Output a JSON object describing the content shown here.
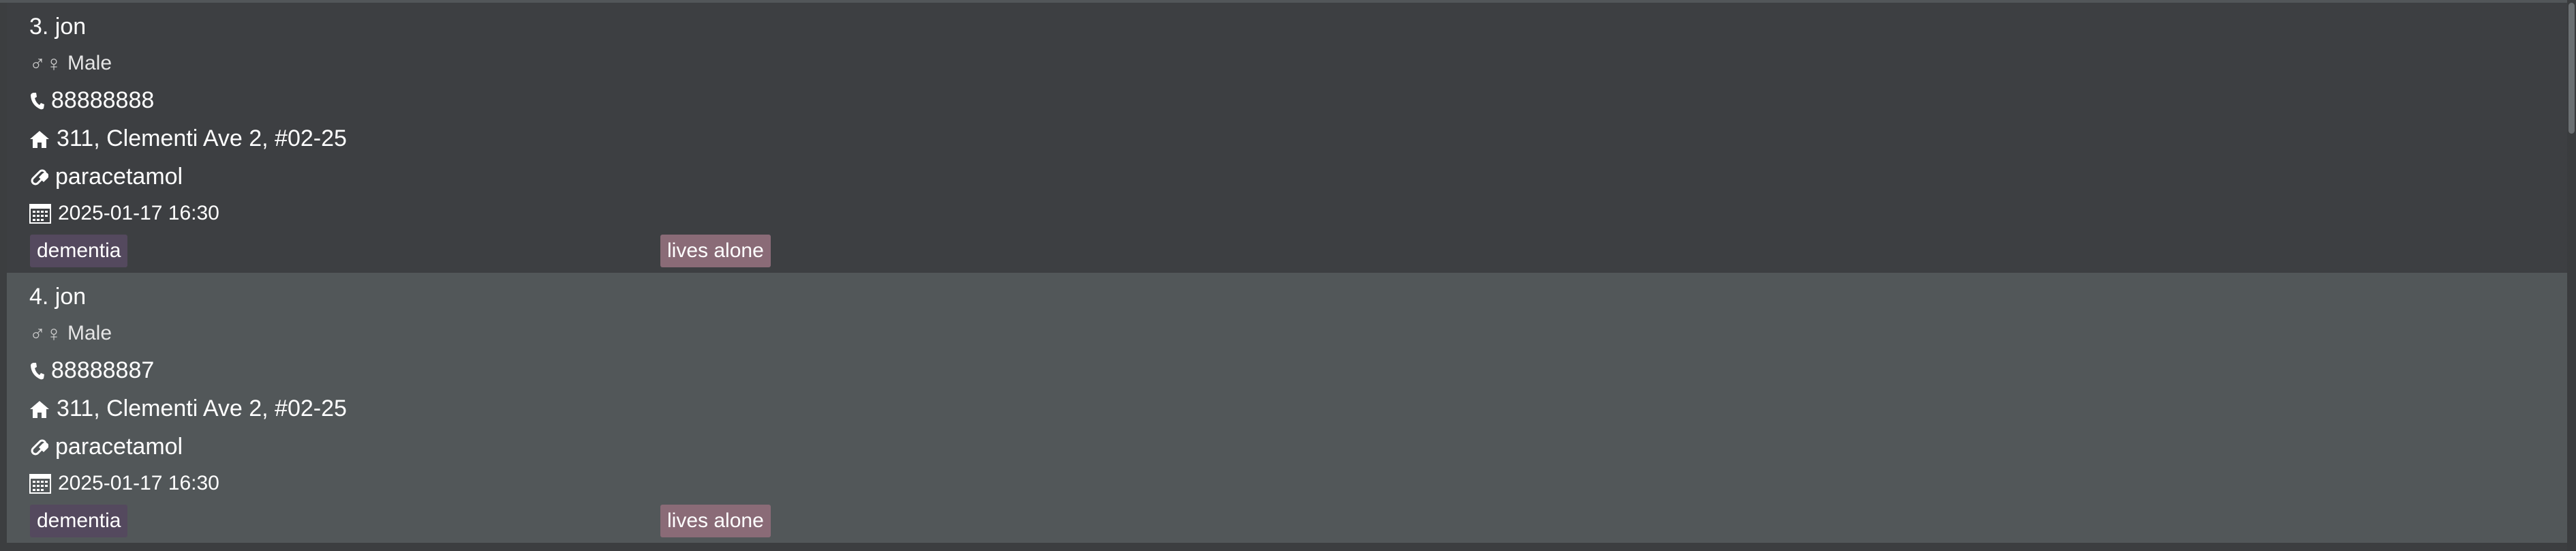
{
  "persons": [
    {
      "index_name": "3. jon",
      "gender": "Male",
      "phone": "88888888",
      "address": "311, Clementi Ave 2, #02-25",
      "medication": "paracetamol",
      "appointment": "2025-01-17 16:30",
      "tags": [
        "dementia",
        "lives alone"
      ]
    },
    {
      "index_name": "4. jon",
      "gender": "Male",
      "phone": "88888887",
      "address": "311, Clementi Ave 2, #02-25",
      "medication": "paracetamol",
      "appointment": "2025-01-17 16:30",
      "tags": [
        "dementia",
        "lives alone"
      ]
    }
  ],
  "icons": {
    "gender": "gender-icon",
    "phone": "phone-icon",
    "address": "home-icon",
    "medication": "pill-icon",
    "appointment": "calendar-icon"
  },
  "colors": {
    "list_background": "#3c3e40",
    "selected_card_background": "#525759",
    "tag_dementia": "#54495e",
    "tag_lives_alone": "#8a6b77"
  }
}
